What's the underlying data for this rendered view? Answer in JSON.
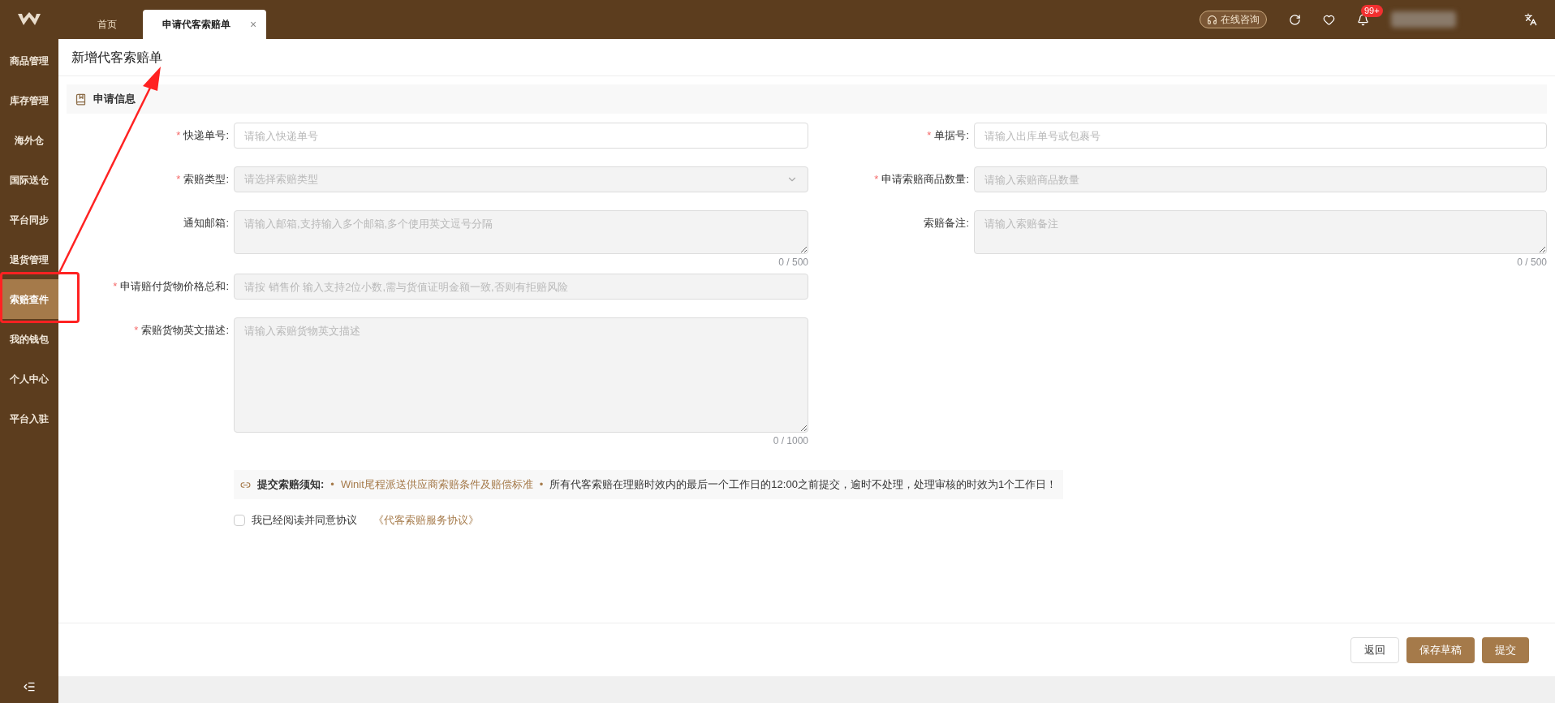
{
  "tabs": [
    {
      "label": "首页",
      "selected": false
    },
    {
      "label": "申请代客索赔单",
      "selected": true,
      "close": "×"
    }
  ],
  "header": {
    "consult": "在线咨询",
    "badge": "99+"
  },
  "sidebar": {
    "items": [
      {
        "label": "商品管理",
        "selected": false
      },
      {
        "label": "库存管理",
        "selected": false
      },
      {
        "label": "海外仓",
        "selected": false
      },
      {
        "label": "国际送仓",
        "selected": false
      },
      {
        "label": "平台同步",
        "selected": false
      },
      {
        "label": "退货管理",
        "selected": false
      },
      {
        "label": "索赔查件",
        "selected": true
      },
      {
        "label": "我的钱包",
        "selected": false
      },
      {
        "label": "个人中心",
        "selected": false
      },
      {
        "label": "平台入驻",
        "selected": false
      }
    ]
  },
  "page_title": "新增代客索赔单",
  "section_title": "申请信息",
  "form": {
    "left": [
      {
        "kind": "input",
        "label": "快递单号:",
        "required_mark": "*",
        "placeholder": "请输入快递单号",
        "disabled": false
      },
      {
        "kind": "select",
        "label": "索赔类型:",
        "required_mark": "*",
        "placeholder": "请选择索赔类型",
        "disabled": true
      },
      {
        "kind": "textarea",
        "label": "通知邮箱:",
        "placeholder": "请输入邮箱,支持输入多个邮箱,多个使用英文逗号分隔",
        "disabled": true,
        "counter": "0 / 500"
      },
      {
        "kind": "input",
        "label": "申请赔付货物价格总和:",
        "required_mark": "*",
        "placeholder": "请按 销售价 输入支持2位小数,需与货值证明金额一致,否则有拒赔风险",
        "disabled": true
      },
      {
        "kind": "tallarea",
        "label": "索赔货物英文描述:",
        "required_mark": "*",
        "placeholder": "请输入索赔货物英文描述",
        "disabled": true,
        "counter": "0 / 1000"
      }
    ],
    "right": [
      {
        "kind": "input",
        "label": "单据号:",
        "required_mark": "*",
        "placeholder": "请输入出库单号或包裹号",
        "disabled": false
      },
      {
        "kind": "input",
        "label": "申请索赔商品数量:",
        "required_mark": "*",
        "placeholder": "请输入索赔商品数量",
        "disabled": true
      },
      {
        "kind": "textarea",
        "label": "索赔备注:",
        "placeholder": "请输入索赔备注",
        "disabled": true,
        "counter": "0 / 500"
      }
    ]
  },
  "notice": {
    "title": "提交索赔须知:",
    "bullet": "•",
    "link": "Winit尾程派送供应商索赔条件及赔偿标准",
    "text": "所有代客索赔在理赔时效内的最后一个工作日的12:00之前提交，逾时不处理，处理审核的时效为1个工作日！"
  },
  "agreement": {
    "checked": false,
    "label": "我已经阅读并同意协议",
    "link": "《代客索赔服务协议》"
  },
  "buttons": [
    {
      "label": "返回",
      "kind": "default"
    },
    {
      "label": "保存草稿",
      "kind": "primary"
    },
    {
      "label": "提交",
      "kind": "primary"
    }
  ],
  "annotation": {
    "shown": true
  }
}
